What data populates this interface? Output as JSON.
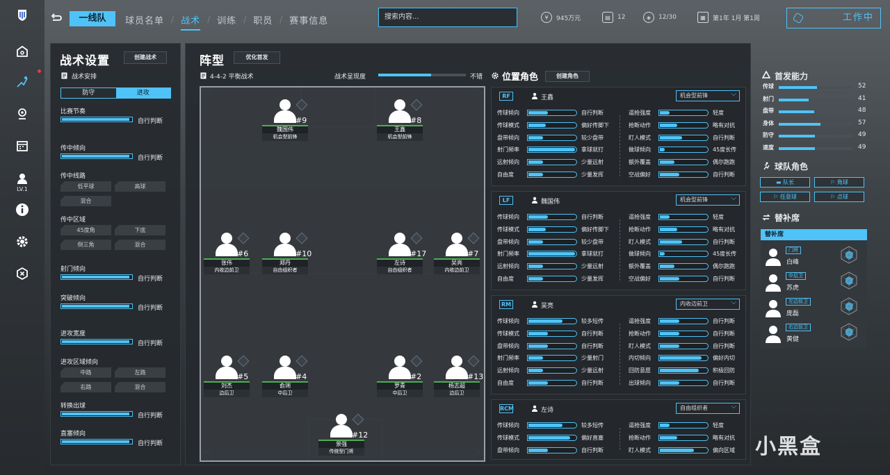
{
  "rail": {
    "level": "LV.1"
  },
  "topbar": {
    "team_tab": "一线队",
    "tabs": [
      "球员名单",
      "战术",
      "训练",
      "职员",
      "赛事信息"
    ],
    "search_placeholder": "搜索内容...",
    "money": "945万元",
    "stat2": "12",
    "stat3": "12/30",
    "date": "第1年 1月 第1周",
    "work_label": "工作中"
  },
  "tactics": {
    "title": "战术设置",
    "create_btn": "创建战术",
    "arrange_label": "战术安排",
    "seg": [
      "防守",
      "进攻"
    ],
    "sliders": [
      {
        "label": "比赛节奏",
        "value": "自行判断",
        "fill": 0.95
      },
      {
        "label": "传中倾向",
        "value": "自行判断",
        "fill": 0.95
      },
      {
        "label": "射门倾向",
        "value": "自行判断",
        "fill": 0.95
      },
      {
        "label": "突破倾向",
        "value": "自行判断",
        "fill": 0.95
      },
      {
        "label": "进攻宽度",
        "value": "自行判断",
        "fill": 0.95
      },
      {
        "label": "转换出球",
        "value": "自行判断",
        "fill": 0.95
      },
      {
        "label": "直塞倾向",
        "value": "自行判断",
        "fill": 0.95
      }
    ],
    "cross_route": {
      "label": "传中线路",
      "options": [
        "低平球",
        "高球",
        "混合"
      ]
    },
    "cross_zone": {
      "label": "传中区域",
      "options": [
        "45度角",
        "下底",
        "倒三角",
        "混合"
      ]
    },
    "attack_zone": {
      "label": "进攻区域倾向",
      "options": [
        "中路",
        "左路",
        "右路",
        "混合"
      ]
    }
  },
  "formation": {
    "title": "阵型",
    "optimize_btn": "优化首发",
    "name": "4-4-2 平衡战术",
    "performance_label": "战术呈现度",
    "performance_value": "不错",
    "performance_fill": 0.6,
    "players": [
      {
        "num": "#9",
        "name": "魏国伟",
        "role": "机会型前锋"
      },
      {
        "num": "#8",
        "name": "王鑫",
        "role": "机会型前锋"
      },
      {
        "num": "#6",
        "name": "张伟",
        "role": "内收边前卫"
      },
      {
        "num": "#10",
        "name": "郑丹",
        "role": "自由组织者"
      },
      {
        "num": "#17",
        "name": "左诗",
        "role": "自由组织者"
      },
      {
        "num": "#7",
        "name": "吴亮",
        "role": "内收边前卫"
      },
      {
        "num": "#5",
        "name": "刘杰",
        "role": "边后卫"
      },
      {
        "num": "#4",
        "name": "俞琍",
        "role": "中后卫"
      },
      {
        "num": "#2",
        "name": "罗青",
        "role": "中后卫"
      },
      {
        "num": "#13",
        "name": "杨志超",
        "role": "边后卫"
      },
      {
        "num": "#12",
        "name": "景强",
        "role": "传统型门将"
      }
    ]
  },
  "roles": {
    "title": "位置角色",
    "create_btn": "创建角色",
    "cards": [
      {
        "pos": "RF",
        "name": "王鑫",
        "role": "机会型前锋",
        "left": [
          [
            "传球倾向",
            "自行判断",
            0.4
          ],
          [
            "传球模式",
            "偏好传脚下",
            0.35
          ],
          [
            "盘带倾向",
            "较少盘带",
            0.3
          ],
          [
            "射门频率",
            "拿球就打",
            0.95
          ],
          [
            "远射倾向",
            "少量远射",
            0.3
          ],
          [
            "自由度",
            "少量发挥",
            0.3
          ]
        ],
        "right": [
          [
            "逼抢强度",
            "轻度",
            0.2
          ],
          [
            "抢断动作",
            "略有对抗",
            0.35
          ],
          [
            "盯人模式",
            "自行判断",
            0.45
          ],
          [
            "做球倾向",
            "45度长传",
            0.1
          ],
          [
            "额外覆盖",
            "偶尔跑跑",
            0.3
          ],
          [
            "空战偏好",
            "自行判断",
            0.4
          ]
        ]
      },
      {
        "pos": "LF",
        "name": "魏国伟",
        "role": "机会型前锋",
        "left": [
          [
            "传球倾向",
            "自行判断",
            0.4
          ],
          [
            "传球模式",
            "偏好传脚下",
            0.35
          ],
          [
            "盘带倾向",
            "较少盘带",
            0.3
          ],
          [
            "射门频率",
            "拿球就打",
            0.95
          ],
          [
            "远射倾向",
            "少量远射",
            0.3
          ],
          [
            "自由度",
            "少量发挥",
            0.3
          ]
        ],
        "right": [
          [
            "逼抢强度",
            "轻度",
            0.2
          ],
          [
            "抢断动作",
            "略有对抗",
            0.35
          ],
          [
            "盯人模式",
            "自行判断",
            0.45
          ],
          [
            "做球倾向",
            "45度长传",
            0.1
          ],
          [
            "额外覆盖",
            "偶尔跑跑",
            0.3
          ],
          [
            "空战偏好",
            "自行判断",
            0.4
          ]
        ]
      },
      {
        "pos": "RM",
        "name": "吴亮",
        "role": "内收边前卫",
        "left": [
          [
            "传球倾向",
            "较多短传",
            0.7
          ],
          [
            "传球模式",
            "自行判断",
            0.4
          ],
          [
            "盘带倾向",
            "自行判断",
            0.4
          ],
          [
            "射门频率",
            "少量射门",
            0.3
          ],
          [
            "远射倾向",
            "少量远射",
            0.3
          ],
          [
            "自由度",
            "自行判断",
            0.4
          ]
        ],
        "right": [
          [
            "逼抢强度",
            "自行判断",
            0.4
          ],
          [
            "抢断动作",
            "自行判断",
            0.4
          ],
          [
            "盯人模式",
            "自行判断",
            0.4
          ],
          [
            "内切倾向",
            "偏好内切",
            0.85
          ],
          [
            "回防意愿",
            "积极回防",
            0.8
          ],
          [
            "出球倾向",
            "自行判断",
            0.4
          ]
        ]
      },
      {
        "pos": "RCM",
        "name": "左诗",
        "role": "自由组织者",
        "left": [
          [
            "传球倾向",
            "较多短传",
            0.7
          ],
          [
            "传球模式",
            "偏好直塞",
            0.85
          ],
          [
            "盘带倾向",
            "自行判断",
            0.4
          ]
        ],
        "right": [
          [
            "逼抢强度",
            "轻度",
            0.2
          ],
          [
            "抢断动作",
            "略有对抗",
            0.35
          ],
          [
            "盯人模式",
            "偏向区域",
            0.7
          ]
        ]
      }
    ]
  },
  "starters": {
    "title": "首发能力",
    "stats": [
      [
        "传球",
        52
      ],
      [
        "射门",
        41
      ],
      [
        "盘带",
        48
      ],
      [
        "身体",
        57
      ],
      [
        "防守",
        49
      ],
      [
        "速度",
        49
      ]
    ]
  },
  "team_roles": {
    "title": "球队角色",
    "buttons": [
      "队长",
      "角球",
      "任意球",
      "点球"
    ]
  },
  "bench": {
    "title": "替补席",
    "header": "替补席",
    "subs": [
      {
        "tag": "门将",
        "name": "白峰"
      },
      {
        "tag": "中后卫",
        "name": "苏虎"
      },
      {
        "tag": "左边前卫",
        "name": "庞磊"
      },
      {
        "tag": "右边前卫",
        "name": "黄健"
      }
    ]
  },
  "watermark": "小黑盒",
  "colors": {
    "accent": "#4fc3f7",
    "name_bar": "#4caf50"
  }
}
